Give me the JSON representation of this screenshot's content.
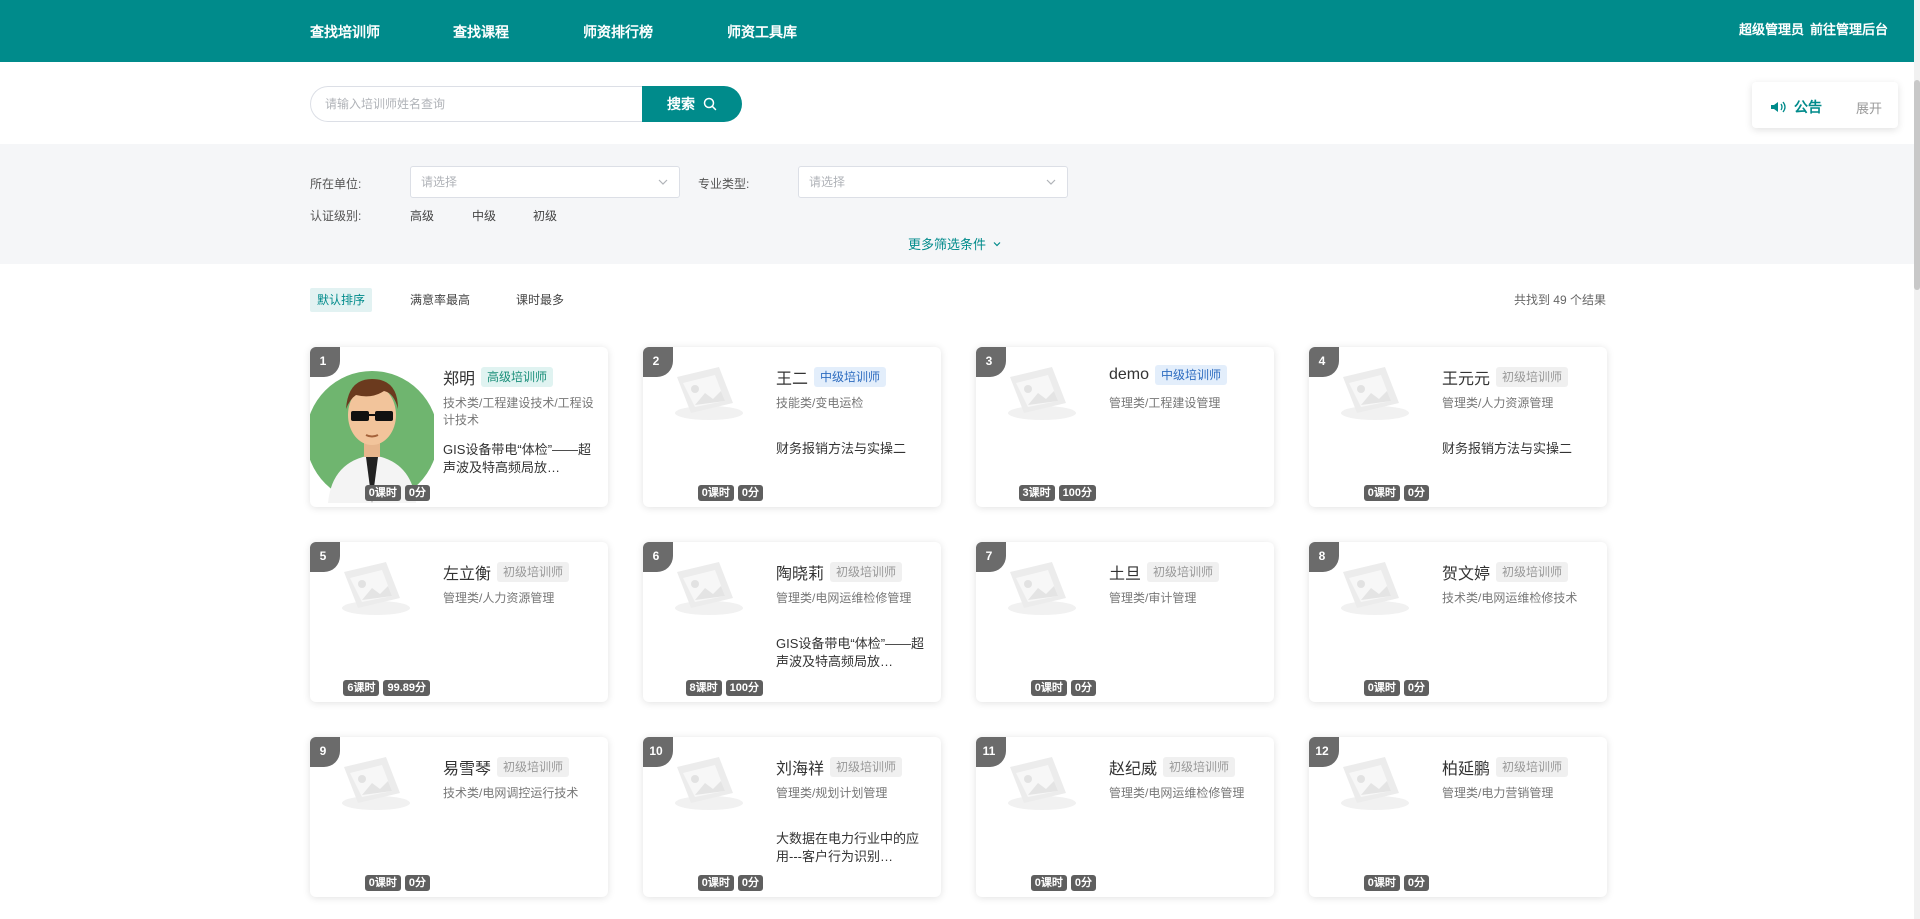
{
  "nav": {
    "items": [
      {
        "label": "查找培训师"
      },
      {
        "label": "查找课程"
      },
      {
        "label": "师资排行榜"
      },
      {
        "label": "师资工具库"
      }
    ],
    "user": "超级管理员",
    "admin_link": "前往管理后台"
  },
  "search": {
    "placeholder": "请输入培训师姓名查询",
    "button_label": "搜索",
    "icon": "search-icon"
  },
  "notice": {
    "label": "公告",
    "expand_label": "展开",
    "icon": "speaker-icon"
  },
  "filters": {
    "unit_label": "所在单位:",
    "unit_placeholder": "请选择",
    "major_label": "专业类型:",
    "major_placeholder": "请选择",
    "level_label": "认证级别:",
    "levels": [
      "高级",
      "中级",
      "初级"
    ],
    "more_label": "更多筛选条件"
  },
  "sort": {
    "options": [
      "默认排序",
      "满意率最高",
      "课时最多"
    ],
    "active": "默认排序"
  },
  "result_text": "共找到 49 个结果",
  "colors": {
    "primary": "#008b8b",
    "badge_high": "#1a8f7a",
    "badge_mid": "#2d6cc0",
    "badge_low": "#999999"
  },
  "trainers": [
    {
      "rank": "1",
      "name": "郑明",
      "level": "高级培训师",
      "level_type": "high",
      "spec": "技术类/工程建设技术/工程设计技术",
      "course": "GIS设备带电“体检”——超声波及特高频局放…",
      "hours": "0课时",
      "score": "0分",
      "has_photo": true
    },
    {
      "rank": "2",
      "name": "王二",
      "level": "中级培训师",
      "level_type": "mid",
      "spec": "技能类/变电运检",
      "course": "财务报销方法与实操二",
      "hours": "0课时",
      "score": "0分",
      "has_photo": false
    },
    {
      "rank": "3",
      "name": "demo",
      "level": "中级培训师",
      "level_type": "mid",
      "spec": "管理类/工程建设管理",
      "course": "",
      "hours": "3课时",
      "score": "100分",
      "has_photo": false
    },
    {
      "rank": "4",
      "name": "王元元",
      "level": "初级培训师",
      "level_type": "low",
      "spec": "管理类/人力资源管理",
      "course": "财务报销方法与实操二",
      "hours": "0课时",
      "score": "0分",
      "has_photo": false
    },
    {
      "rank": "5",
      "name": "左立衡",
      "level": "初级培训师",
      "level_type": "low",
      "spec": "管理类/人力资源管理",
      "course": "",
      "hours": "6课时",
      "score": "99.89分",
      "has_photo": false
    },
    {
      "rank": "6",
      "name": "陶晓莉",
      "level": "初级培训师",
      "level_type": "low",
      "spec": "管理类/电网运维检修管理",
      "course": "GIS设备带电“体检”——超声波及特高频局放…",
      "hours": "8课时",
      "score": "100分",
      "has_photo": false
    },
    {
      "rank": "7",
      "name": "土旦",
      "level": "初级培训师",
      "level_type": "low",
      "spec": "管理类/审计管理",
      "course": "",
      "hours": "0课时",
      "score": "0分",
      "has_photo": false
    },
    {
      "rank": "8",
      "name": "贺文婷",
      "level": "初级培训师",
      "level_type": "low",
      "spec": "技术类/电网运维检修技术",
      "course": "",
      "hours": "0课时",
      "score": "0分",
      "has_photo": false
    },
    {
      "rank": "9",
      "name": "易雪琴",
      "level": "初级培训师",
      "level_type": "low",
      "spec": "技术类/电网调控运行技术",
      "course": "",
      "hours": "0课时",
      "score": "0分",
      "has_photo": false
    },
    {
      "rank": "10",
      "name": "刘海祥",
      "level": "初级培训师",
      "level_type": "low",
      "spec": "管理类/规划计划管理",
      "course": "大数据在电力行业中的应用---客户行为识别…",
      "hours": "0课时",
      "score": "0分",
      "has_photo": false
    },
    {
      "rank": "11",
      "name": "赵纪威",
      "level": "初级培训师",
      "level_type": "low",
      "spec": "管理类/电网运维检修管理",
      "course": "",
      "hours": "0课时",
      "score": "0分",
      "has_photo": false
    },
    {
      "rank": "12",
      "name": "柏延鹏",
      "level": "初级培训师",
      "level_type": "low",
      "spec": "管理类/电力营销管理",
      "course": "",
      "hours": "0课时",
      "score": "0分",
      "has_photo": false
    }
  ]
}
